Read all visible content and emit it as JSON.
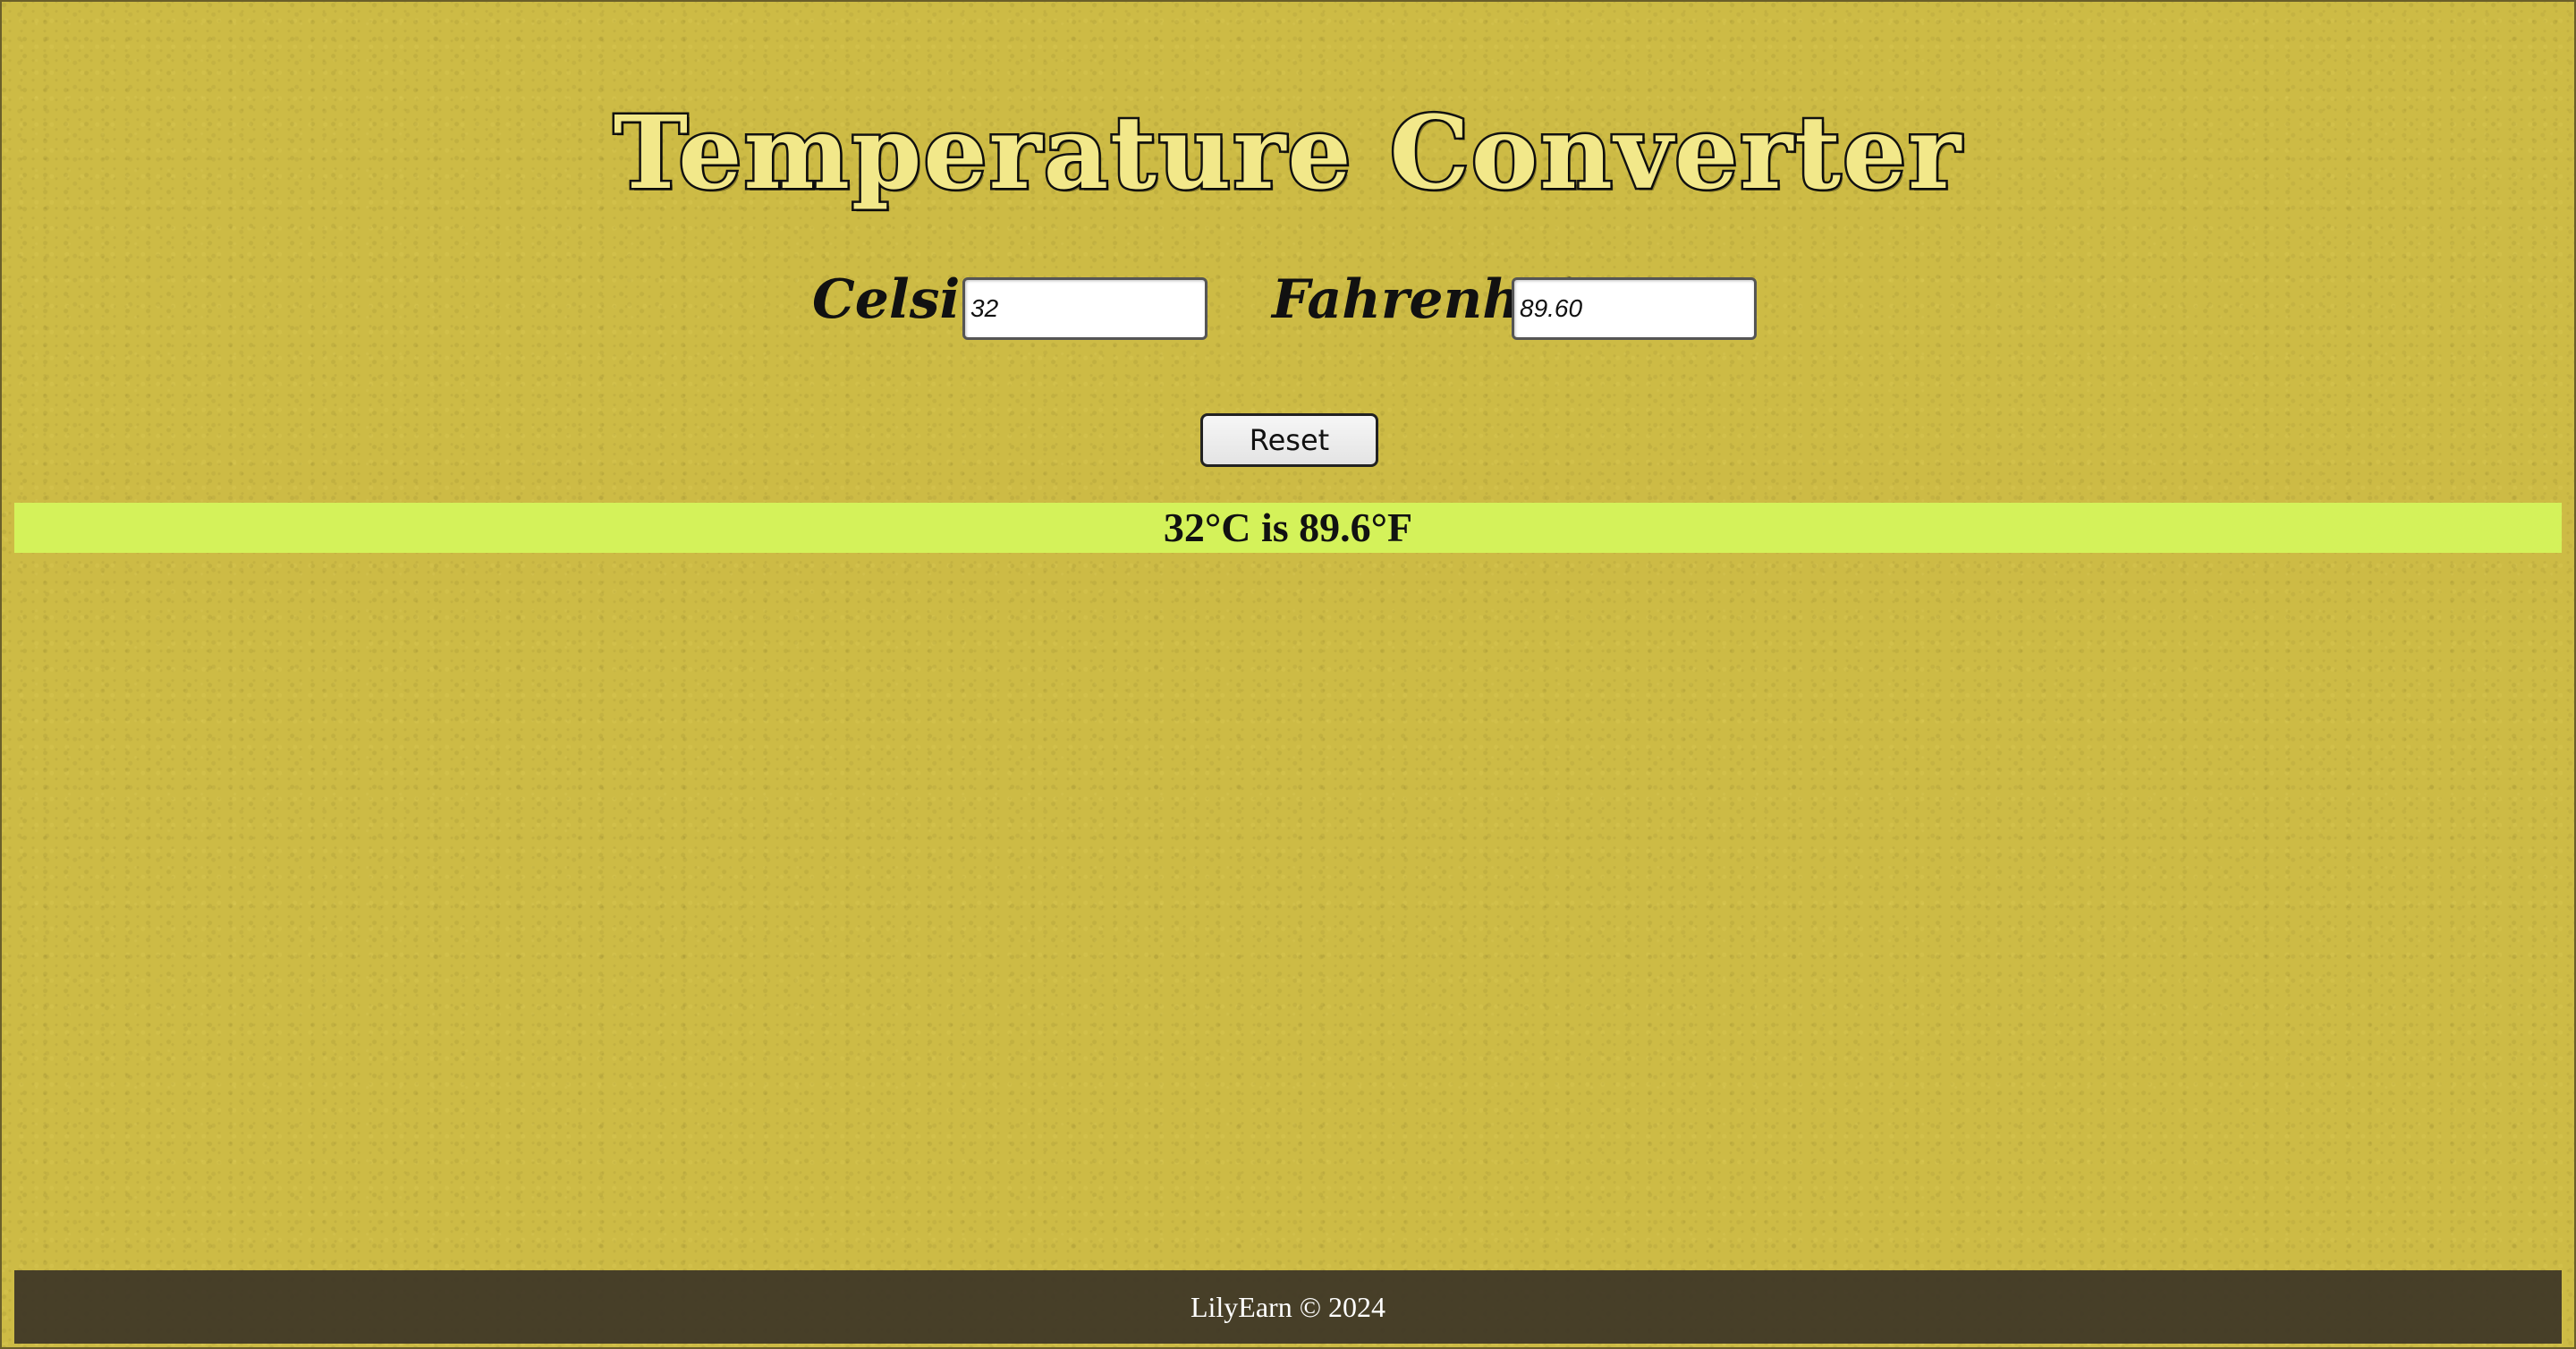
{
  "page": {
    "title": "Temperature Converter"
  },
  "form": {
    "celsius_label": "Celsius:",
    "celsius_value": "32",
    "fahrenheit_label": "Fahrenheit:",
    "fahrenheit_value": "89.60",
    "reset_label": "Reset"
  },
  "result": {
    "text": "32°C is 89.6°F"
  },
  "footer": {
    "text": "LilyEarn © 2024"
  },
  "colors": {
    "background": "#cdbb45",
    "result_bar": "#d4f25a",
    "footer_bar": "#3c3426",
    "title_text": "#111111"
  }
}
